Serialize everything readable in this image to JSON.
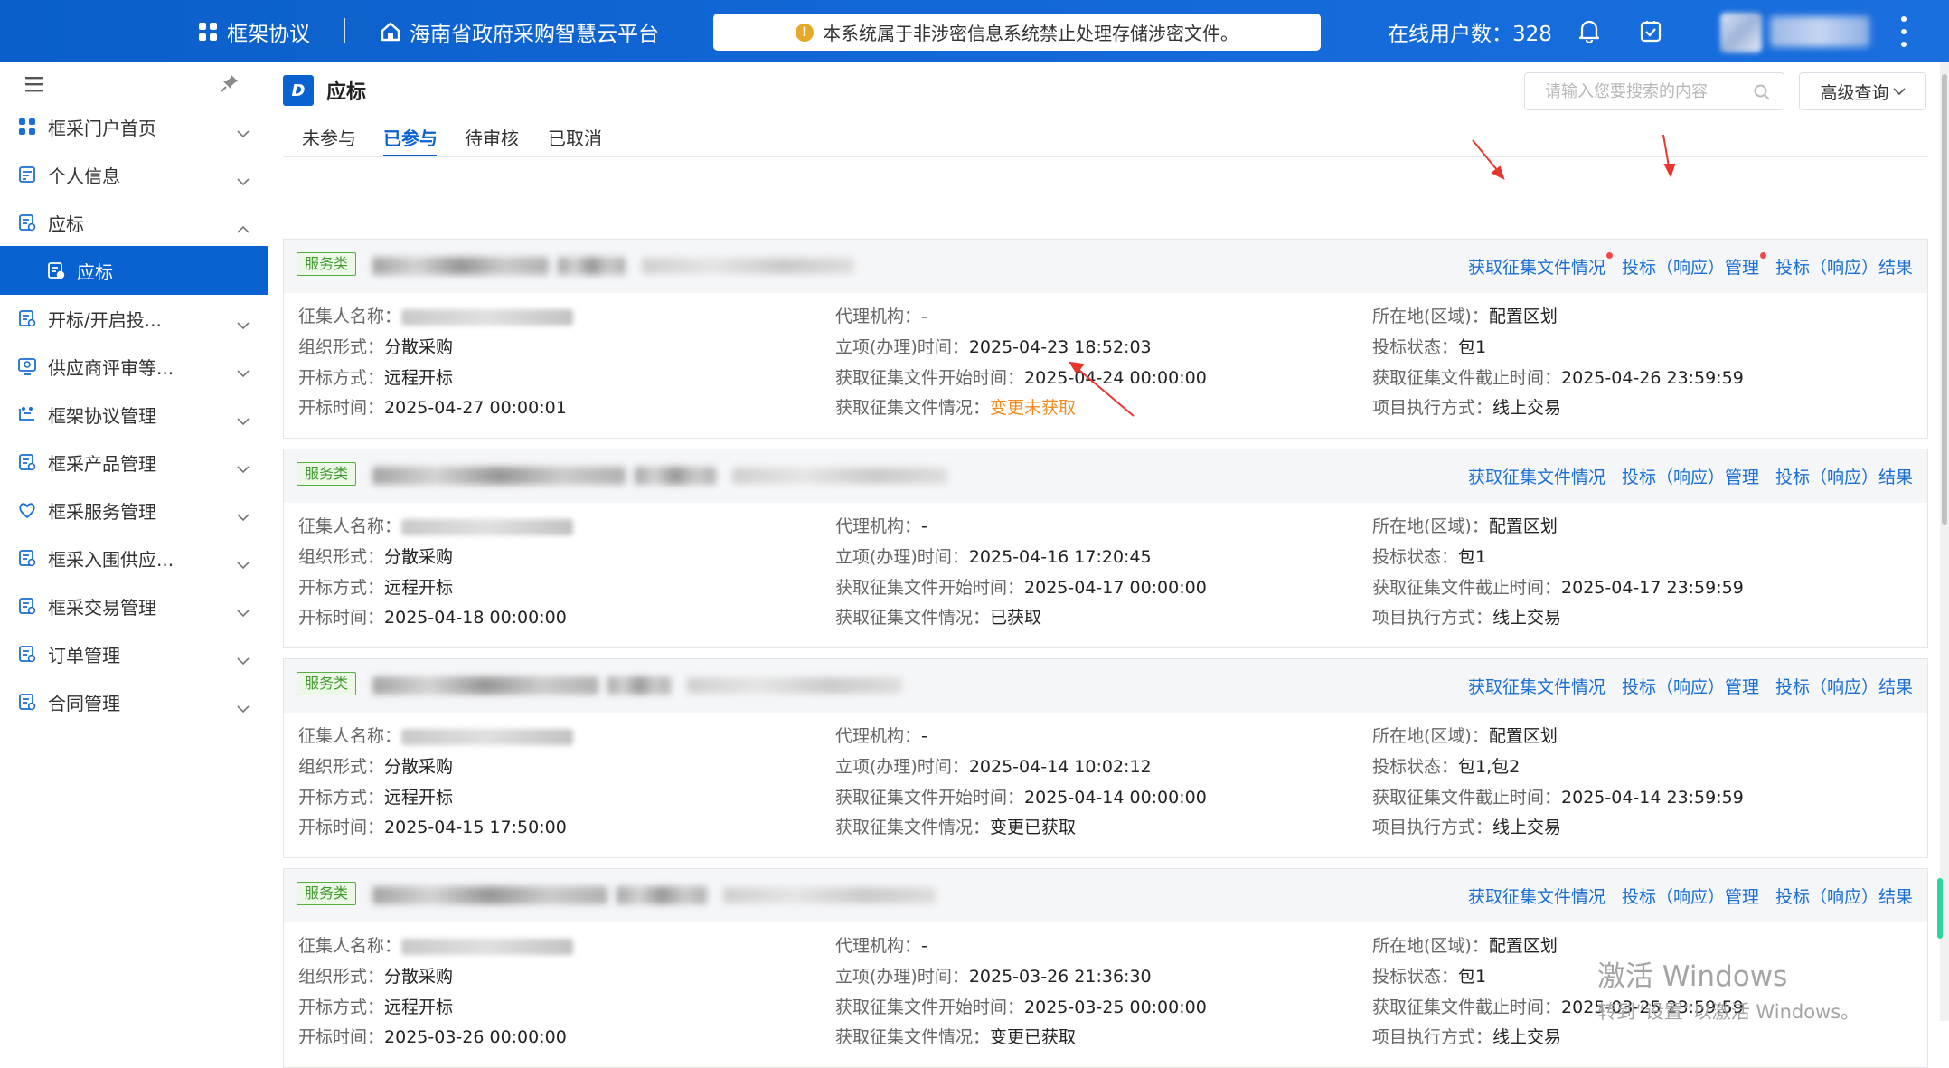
{
  "topbar": {
    "app_name": "框架协议",
    "platform_name": "海南省政府采购智慧云平台",
    "notice": "本系统属于非涉密信息系统禁止处理存储涉密文件。",
    "online_users": "在线用户数：328",
    "icons": [
      "grid-icon",
      "home-icon",
      "info-icon",
      "bell-icon",
      "clipboard-check-icon",
      "more-icon"
    ]
  },
  "sidebar": {
    "items": [
      {
        "label": "框采门户首页",
        "icon": "grid-icon"
      },
      {
        "label": "个人信息",
        "icon": "profile-icon"
      },
      {
        "label": "应标",
        "icon": "doc-icon",
        "expanded": true
      },
      {
        "label": "应标",
        "icon": "doc-icon",
        "active": true
      },
      {
        "label": "开标/开启投...",
        "icon": "doc-icon"
      },
      {
        "label": "供应商评审等...",
        "icon": "review-icon"
      },
      {
        "label": "框架协议管理",
        "icon": "agreement-icon"
      },
      {
        "label": "框采产品管理",
        "icon": "doc-icon"
      },
      {
        "label": "框采服务管理",
        "icon": "service-icon"
      },
      {
        "label": "框采入围供应...",
        "icon": "doc-icon"
      },
      {
        "label": "框采交易管理",
        "icon": "doc-icon"
      },
      {
        "label": "订单管理",
        "icon": "doc-icon"
      },
      {
        "label": "合同管理",
        "icon": "doc-icon"
      }
    ]
  },
  "page": {
    "title": "应标",
    "badge": "D",
    "search_placeholder": "请输入您要搜索的内容",
    "advanced": "高级查询",
    "tabs": [
      "未参与",
      "已参与",
      "待审核",
      "已取消"
    ],
    "active_tab": "已参与"
  },
  "card_actions": {
    "get_docs": "获取征集文件情况",
    "bid_manage": "投标（响应）管理",
    "bid_result": "投标（响应）结果"
  },
  "field_labels": {
    "collector": "征集人名称：",
    "org_form": "组织形式：",
    "open_method": "开标方式：",
    "open_time": "开标时间：",
    "agency": "代理机构：",
    "setup_time": "立项(办理)时间：",
    "doc_start": "获取征集文件开始时间：",
    "doc_status": "获取征集文件情况：",
    "region": "所在地(区域)：",
    "bid_status": "投标状态：",
    "doc_end": "获取征集文件截止时间：",
    "exec_mode": "项目执行方式："
  },
  "cards": [
    {
      "tag": "服务类",
      "org_form": "分散采购",
      "open_method": "远程开标",
      "open_time": "2025-04-27 00:00:01",
      "agency": "-",
      "setup_time": "2025-04-23 18:52:03",
      "doc_start": "2025-04-24 00:00:00",
      "doc_status": "变更未获取",
      "region": "配置区划",
      "bid_status": "包1",
      "doc_end": "2025-04-26 23:59:59",
      "exec_mode": "线上交易"
    },
    {
      "tag": "服务类",
      "org_form": "分散采购",
      "open_method": "远程开标",
      "open_time": "2025-04-18 00:00:00",
      "agency": "-",
      "setup_time": "2025-04-16 17:20:45",
      "doc_start": "2025-04-17 00:00:00",
      "doc_status": "已获取",
      "region": "配置区划",
      "bid_status": "包1",
      "doc_end": "2025-04-17 23:59:59",
      "exec_mode": "线上交易"
    },
    {
      "tag": "服务类",
      "org_form": "分散采购",
      "open_method": "远程开标",
      "open_time": "2025-04-15 17:50:00",
      "agency": "-",
      "setup_time": "2025-04-14 10:02:12",
      "doc_start": "2025-04-14 00:00:00",
      "doc_status": "变更已获取",
      "region": "配置区划",
      "bid_status": "包1,包2",
      "doc_end": "2025-04-14 23:59:59",
      "exec_mode": "线上交易"
    },
    {
      "tag": "服务类",
      "org_form": "分散采购",
      "open_method": "远程开标",
      "open_time": "2025-03-26 00:00:00",
      "agency": "-",
      "setup_time": "2025-03-26 21:36:30",
      "doc_start": "2025-03-25 00:00:00",
      "doc_status": "变更已获取",
      "region": "配置区划",
      "bid_status": "包1",
      "doc_end": "2025-03-25 23:59:59",
      "exec_mode": "线上交易"
    }
  ],
  "watermark": {
    "line1": "激活 Windows",
    "line2": "转到“设置”以激活 Windows。"
  },
  "colors": {
    "primary": "#0a62d0",
    "link": "#1a6fd6",
    "warning": "#f08c1e",
    "tag_green": "#3d9a2a",
    "annotation_red": "#e8352e"
  }
}
